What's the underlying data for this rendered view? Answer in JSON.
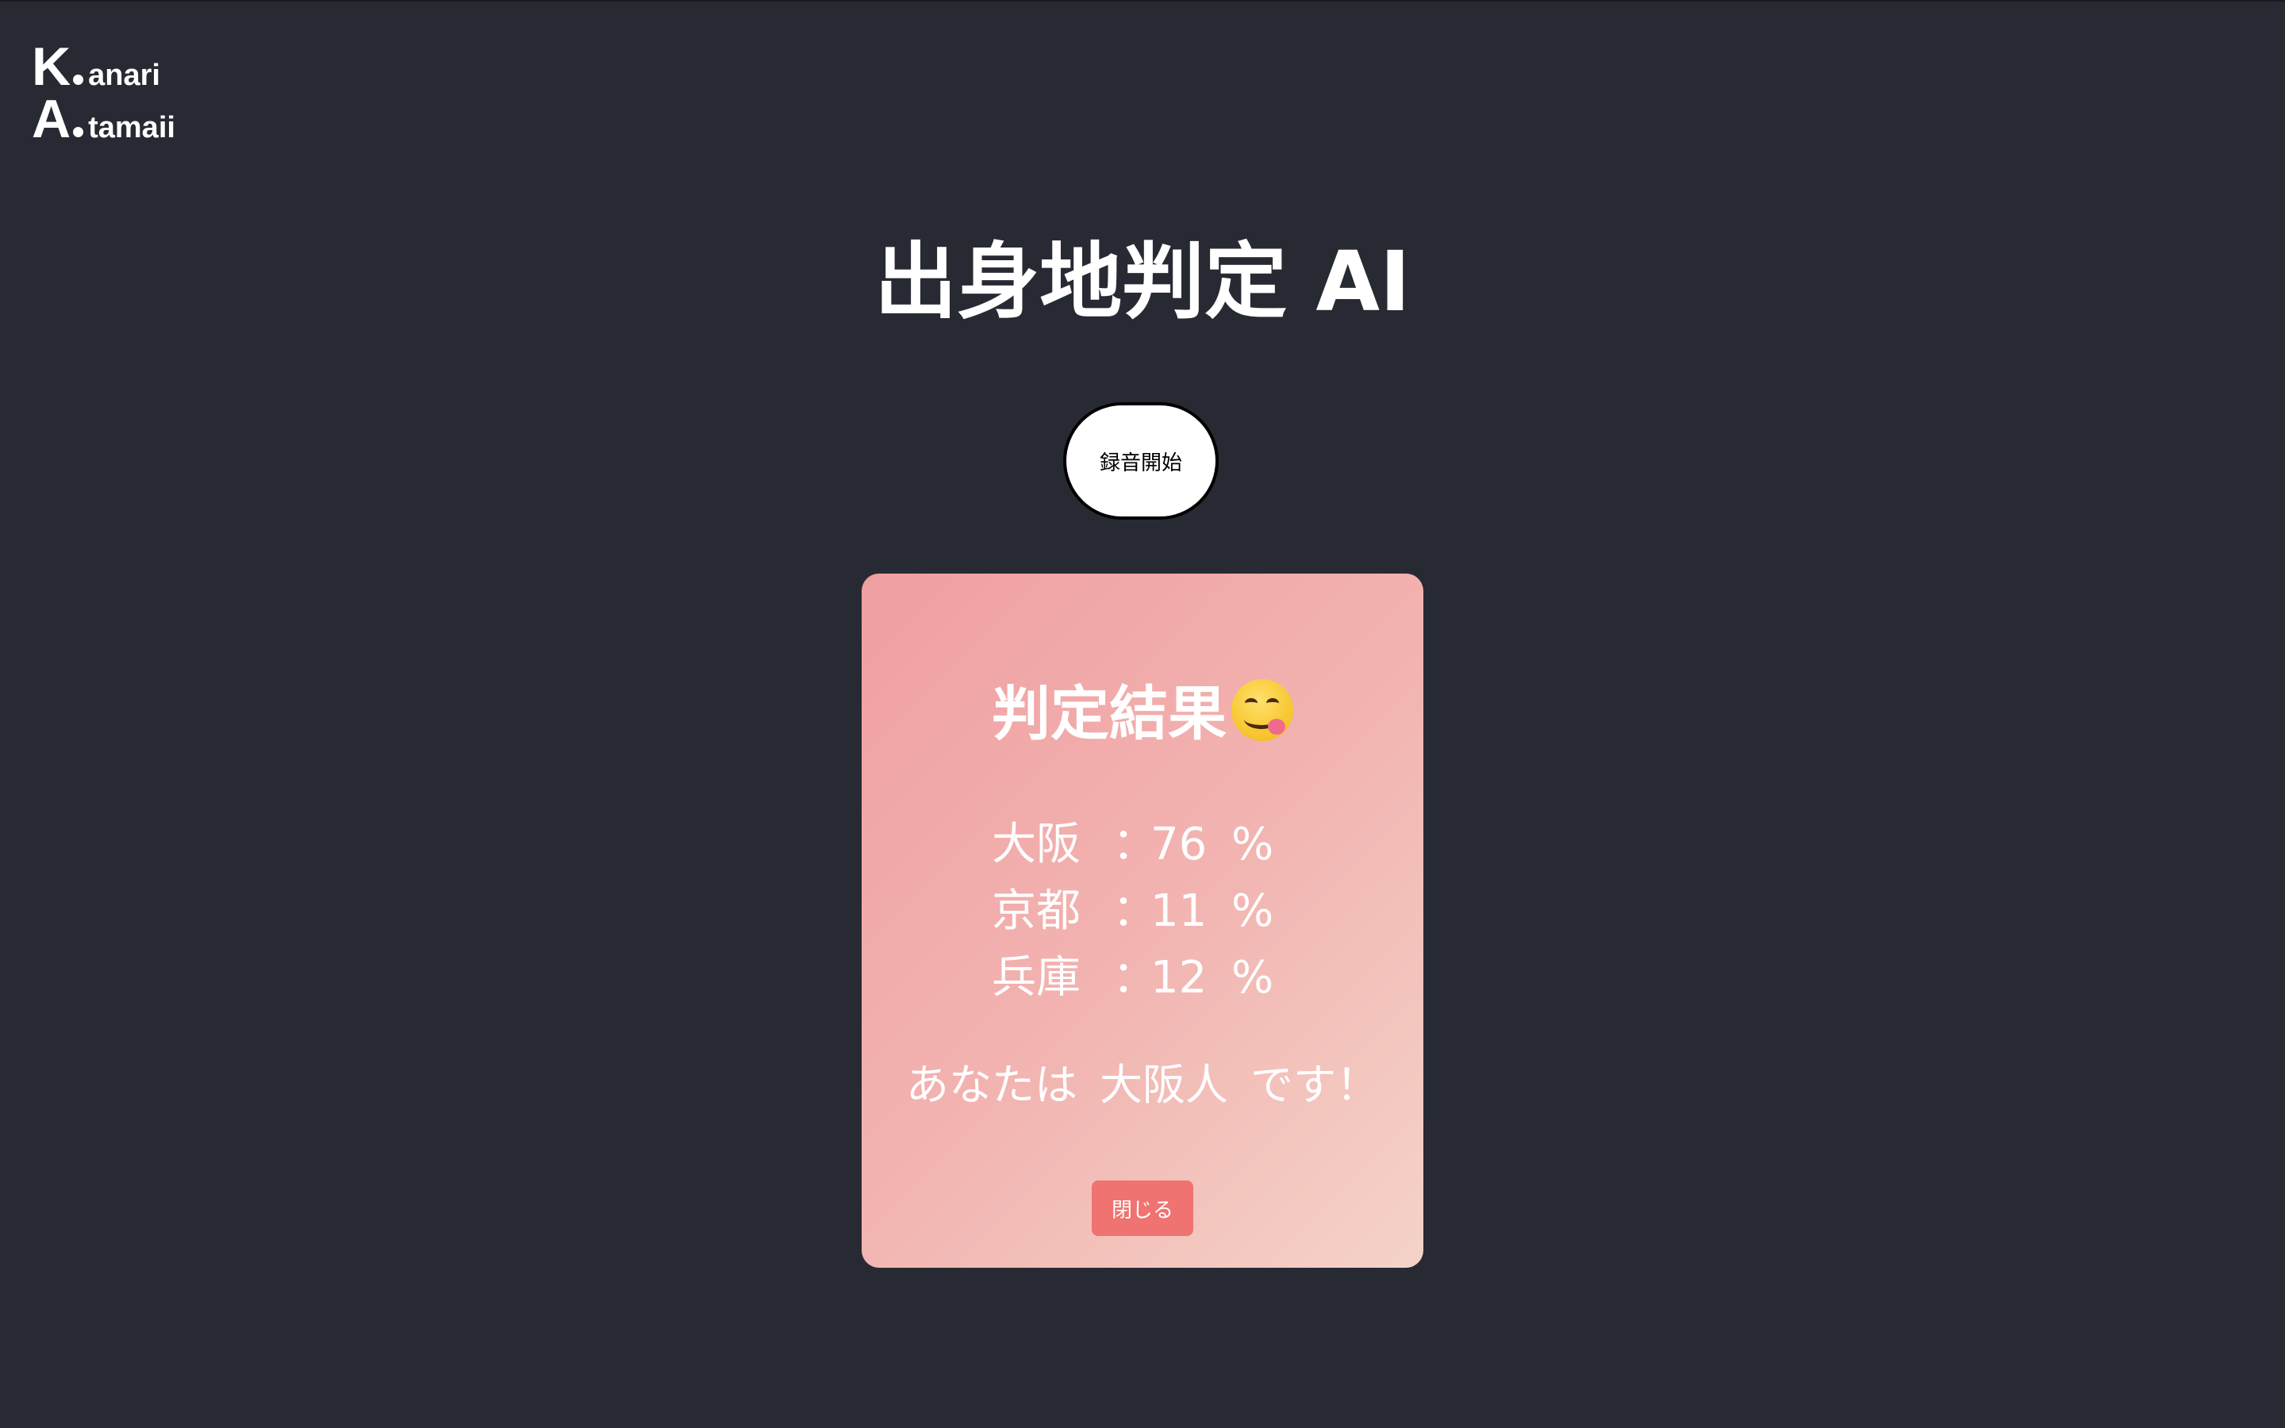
{
  "logo": {
    "line1_initial": "K",
    "line1_word": "anari",
    "line2_initial": "A",
    "line2_word": "tamaii"
  },
  "page_title": "出身地判定 AI",
  "record_button_label": "録音開始",
  "result_card": {
    "title": "判定結果",
    "title_emoji": "savoring-food-face-icon",
    "scores": [
      {
        "region": "大阪",
        "colon": "：",
        "value": "76",
        "unit": "%"
      },
      {
        "region": "京都",
        "colon": "：",
        "value": "11",
        "unit": "%"
      },
      {
        "region": "兵庫",
        "colon": "：",
        "value": "12",
        "unit": "%"
      }
    ],
    "verdict_prefix": "あなたは",
    "verdict_result": "大阪人",
    "verdict_suffix": "です！",
    "close_button_label": "閉じる"
  },
  "colors": {
    "background": "#282a33",
    "card_gradient_start": "#ef9fa1",
    "card_gradient_end": "#f4d3c8",
    "close_button": "#ef7370",
    "record_button_bg": "#ffffff",
    "record_button_border": "#000000"
  }
}
